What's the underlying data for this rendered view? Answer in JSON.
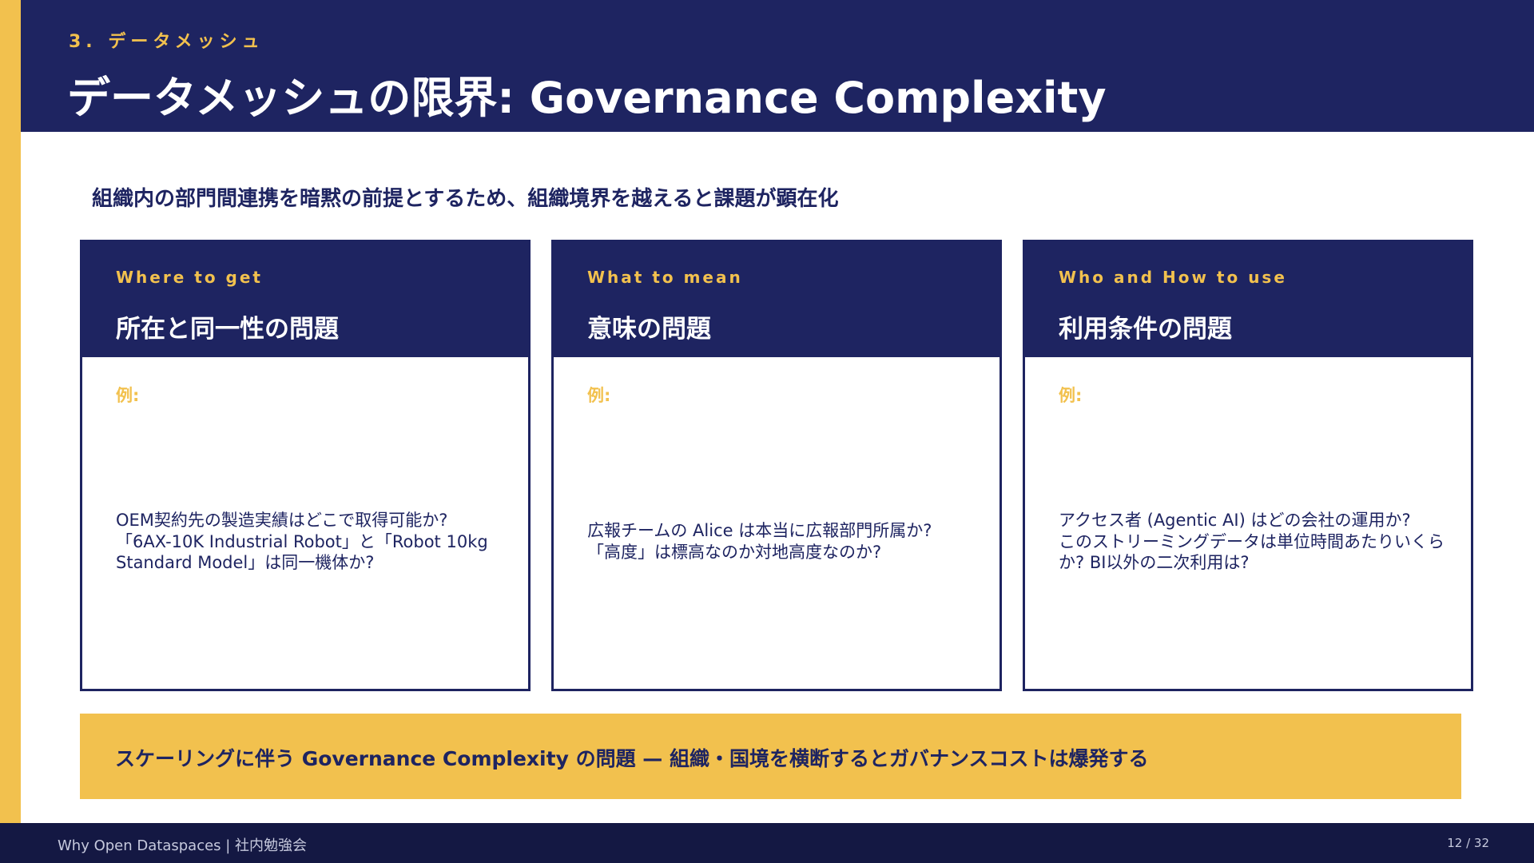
{
  "header": {
    "section_label": "3. データメッシュ",
    "title": "データメッシュの限界: Governance Complexity"
  },
  "lead": "組織内の部門間連携を暗黙の前提とするため、組織境界を越えると課題が顕在化",
  "cards": [
    {
      "eyebrow": "Where to get",
      "title": "所在と同一性の問題",
      "example_label": "例:",
      "text": "OEM契約先の製造実績はどこで取得可能か?\n「6AX-10K Industrial Robot」と「Robot 10kg Standard Model」は同一機体か?"
    },
    {
      "eyebrow": "What to mean",
      "title": "意味の問題",
      "example_label": "例:",
      "text": "広報チームの Alice は本当に広報部門所属か?\n「高度」は標高なのか対地高度なのか?"
    },
    {
      "eyebrow": "Who and How to use",
      "title": "利用条件の問題",
      "example_label": "例:",
      "text": "アクセス者 (Agentic AI) はどの会社の運用か?\nこのストリーミングデータは単位時間あたりいくらか? BI以外の二次利用は?"
    }
  ],
  "callout": "スケーリングに伴う Governance Complexity の問題 — 組織・国境を横断するとガバナンスコストは爆発する",
  "footer": {
    "left": "Why Open Dataspaces | 社内勉強会",
    "page": "12 / 32"
  },
  "colors": {
    "navy": "#1e2461",
    "accent_yellow": "#f2c14e",
    "footer_bg": "#141843"
  }
}
